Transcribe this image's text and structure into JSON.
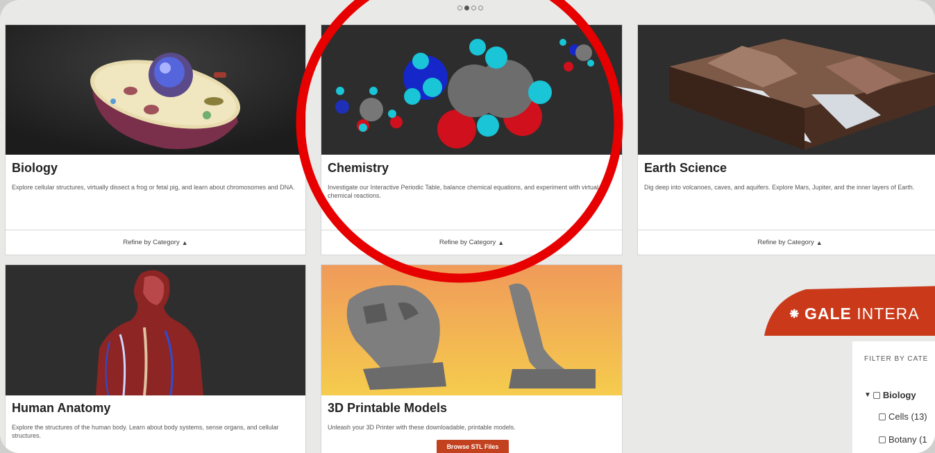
{
  "carousel": {
    "dots": 4,
    "active_index": 1
  },
  "cards": {
    "biology": {
      "title": "Biology",
      "description": "Explore cellular structures, virtually dissect a frog or fetal pig, and learn about chromosomes and DNA.",
      "refine": "Refine by Category"
    },
    "chemistry": {
      "title": "Chemistry",
      "description": "Investigate our Interactive Periodic Table, balance chemical equations, and experiment with virtual chemical reactions.",
      "refine": "Refine by Category"
    },
    "earth": {
      "title": "Earth Science",
      "description": "Dig deep into volcanoes, caves, and aquifers. Explore Mars, Jupiter, and the inner layers of Earth.",
      "refine": "Refine by Category"
    },
    "anatomy": {
      "title": "Human Anatomy",
      "description": "Explore the structures of the human body. Learn about body systems, sense organs, and cellular structures."
    },
    "printable": {
      "title": "3D Printable Models",
      "description": "Unleash your 3D Printer with these downloadable, printable models.",
      "button": "Browse STL Files"
    }
  },
  "gale": {
    "brand": "GALE",
    "suffix": "INTERA"
  },
  "filter": {
    "title": "FILTER BY CATE",
    "items": [
      {
        "label": "Biology"
      },
      {
        "label": "Cells (13)"
      },
      {
        "label": "Botany (1"
      }
    ]
  },
  "colors": {
    "annotation_circle": "#e60000",
    "button": "#c2411f",
    "gale_banner": "#c9391a"
  }
}
